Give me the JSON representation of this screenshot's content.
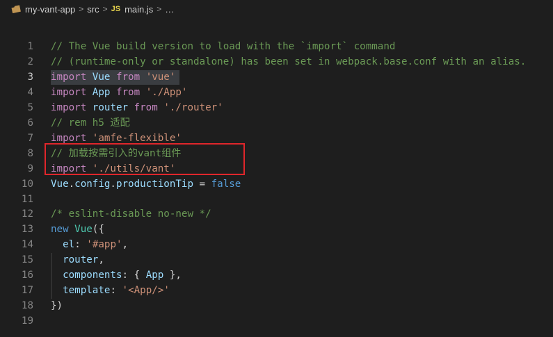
{
  "breadcrumb": {
    "project": "my-vant-app",
    "folder": "src",
    "file_badge": "JS",
    "file": "main.js",
    "more": "…"
  },
  "editor": {
    "active_line": 3,
    "lines": [
      {
        "n": "1",
        "tokens": [
          {
            "t": "// The Vue build version to load with the `import` command",
            "c": "comment"
          }
        ]
      },
      {
        "n": "2",
        "tokens": [
          {
            "t": "// (runtime-only or standalone) has been set in webpack.base.conf with an alias.",
            "c": "comment"
          }
        ]
      },
      {
        "n": "3",
        "tokens": [
          {
            "t": "import",
            "c": "imp"
          },
          {
            "t": " ",
            "c": "plain"
          },
          {
            "t": "Vue",
            "c": "var"
          },
          {
            "t": " ",
            "c": "plain"
          },
          {
            "t": "from",
            "c": "imp"
          },
          {
            "t": " ",
            "c": "plain"
          },
          {
            "t": "'vue'",
            "c": "str"
          }
        ]
      },
      {
        "n": "4",
        "tokens": [
          {
            "t": "import",
            "c": "imp"
          },
          {
            "t": " ",
            "c": "plain"
          },
          {
            "t": "App",
            "c": "var"
          },
          {
            "t": " ",
            "c": "plain"
          },
          {
            "t": "from",
            "c": "imp"
          },
          {
            "t": " ",
            "c": "plain"
          },
          {
            "t": "'./App'",
            "c": "str"
          }
        ]
      },
      {
        "n": "5",
        "tokens": [
          {
            "t": "import",
            "c": "imp"
          },
          {
            "t": " ",
            "c": "plain"
          },
          {
            "t": "router",
            "c": "var"
          },
          {
            "t": " ",
            "c": "plain"
          },
          {
            "t": "from",
            "c": "imp"
          },
          {
            "t": " ",
            "c": "plain"
          },
          {
            "t": "'./router'",
            "c": "str"
          }
        ]
      },
      {
        "n": "6",
        "tokens": [
          {
            "t": "// rem h5 适配",
            "c": "comment"
          }
        ]
      },
      {
        "n": "7",
        "tokens": [
          {
            "t": "import",
            "c": "imp"
          },
          {
            "t": " ",
            "c": "plain"
          },
          {
            "t": "'amfe-flexible'",
            "c": "str"
          }
        ]
      },
      {
        "n": "8",
        "tokens": [
          {
            "t": "// 加载按需引入的vant组件",
            "c": "comment"
          }
        ]
      },
      {
        "n": "9",
        "tokens": [
          {
            "t": "import",
            "c": "imp"
          },
          {
            "t": " ",
            "c": "plain"
          },
          {
            "t": "'./utils/vant'",
            "c": "str"
          }
        ]
      },
      {
        "n": "10",
        "tokens": [
          {
            "t": "Vue",
            "c": "var"
          },
          {
            "t": ".",
            "c": "plain"
          },
          {
            "t": "config",
            "c": "var"
          },
          {
            "t": ".",
            "c": "plain"
          },
          {
            "t": "productionTip",
            "c": "var"
          },
          {
            "t": " = ",
            "c": "plain"
          },
          {
            "t": "false",
            "c": "kw"
          }
        ]
      },
      {
        "n": "11",
        "tokens": []
      },
      {
        "n": "12",
        "tokens": [
          {
            "t": "/* eslint-disable no-new */",
            "c": "comment"
          }
        ]
      },
      {
        "n": "13",
        "tokens": [
          {
            "t": "new",
            "c": "kw"
          },
          {
            "t": " ",
            "c": "plain"
          },
          {
            "t": "Vue",
            "c": "cls"
          },
          {
            "t": "({",
            "c": "plain"
          }
        ]
      },
      {
        "n": "14",
        "tokens": [
          {
            "t": "  ",
            "c": "plain"
          },
          {
            "t": "el",
            "c": "var"
          },
          {
            "t": ": ",
            "c": "plain"
          },
          {
            "t": "'#app'",
            "c": "str"
          },
          {
            "t": ",",
            "c": "plain"
          }
        ]
      },
      {
        "n": "15",
        "tokens": [
          {
            "t": "  ",
            "c": "plain"
          },
          {
            "t": "router",
            "c": "var"
          },
          {
            "t": ",",
            "c": "plain"
          }
        ]
      },
      {
        "n": "16",
        "tokens": [
          {
            "t": "  ",
            "c": "plain"
          },
          {
            "t": "components",
            "c": "var"
          },
          {
            "t": ": { ",
            "c": "plain"
          },
          {
            "t": "App",
            "c": "var"
          },
          {
            "t": " },",
            "c": "plain"
          }
        ]
      },
      {
        "n": "17",
        "tokens": [
          {
            "t": "  ",
            "c": "plain"
          },
          {
            "t": "template",
            "c": "var"
          },
          {
            "t": ": ",
            "c": "plain"
          },
          {
            "t": "'<App/>'",
            "c": "str"
          }
        ]
      },
      {
        "n": "18",
        "tokens": [
          {
            "t": "})",
            "c": "plain"
          }
        ]
      },
      {
        "n": "19",
        "tokens": []
      }
    ]
  },
  "colors": {
    "background": "#1e1e1e",
    "annotation_box": "#e0262b",
    "comment": "#6a9955",
    "keyword": "#569cd6",
    "import": "#c586c0",
    "string": "#ce9178",
    "variable": "#9cdcfe"
  },
  "icons": {
    "folder": "folder-icon",
    "separator": "chevron-right-icon"
  }
}
